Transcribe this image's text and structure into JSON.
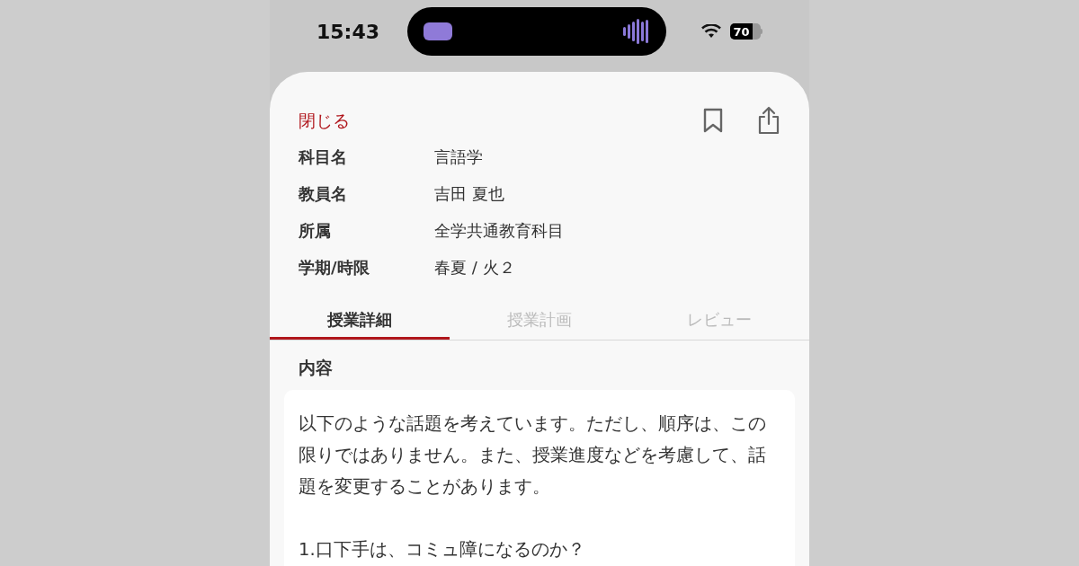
{
  "status_bar": {
    "time": "15:43",
    "battery": "70"
  },
  "sheet": {
    "close": "閉じる",
    "info": [
      {
        "label": "科目名",
        "value": "言語学"
      },
      {
        "label": "教員名",
        "value": "吉田 夏也"
      },
      {
        "label": "所属",
        "value": "全学共通教育科目"
      },
      {
        "label": "学期/時限",
        "value": "春夏 / 火２"
      }
    ],
    "tabs": [
      {
        "label": "授業詳細",
        "selected": true
      },
      {
        "label": "授業計画",
        "selected": false
      },
      {
        "label": "レビュー",
        "selected": false
      }
    ],
    "section_title": "内容",
    "paragraphs": [
      "以下のような話題を考えています。ただし、順序は、この限りではありません。また、授業進度などを考慮して、話題を変更することがあります。",
      "1.口下手は、コミュ障になるのか？"
    ]
  }
}
